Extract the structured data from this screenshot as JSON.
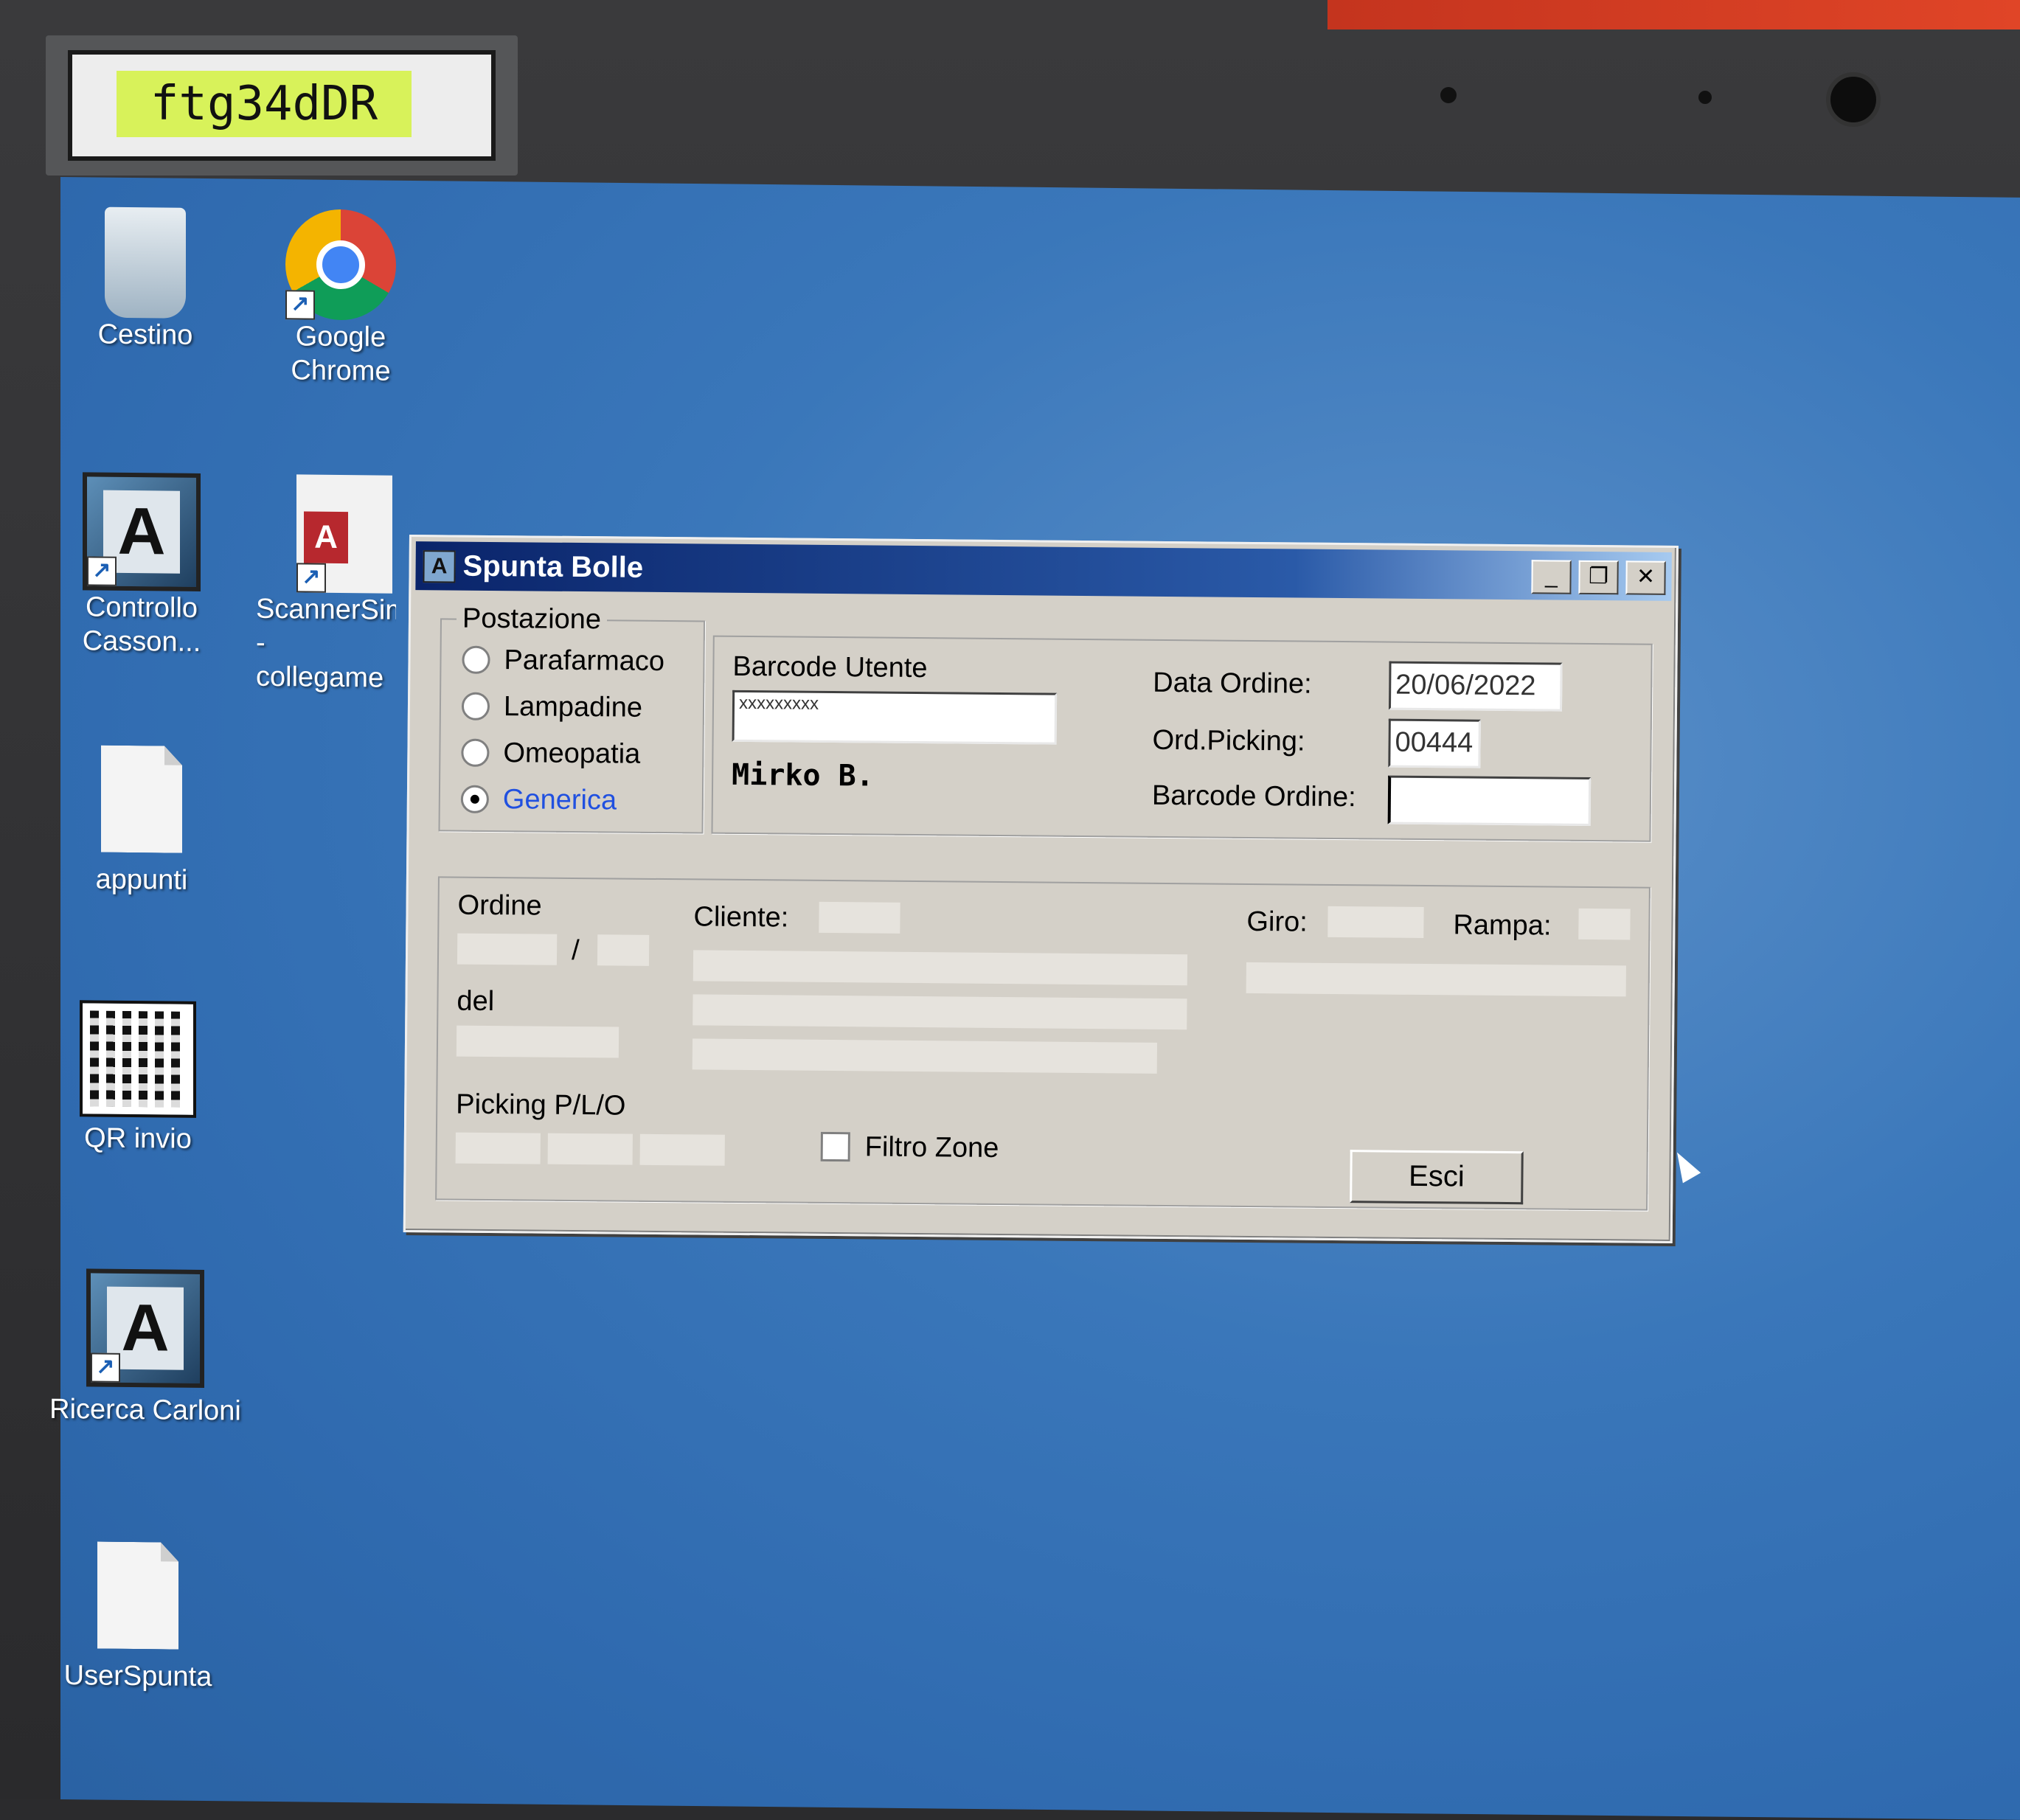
{
  "sticker": {
    "label": "ftg34dDR"
  },
  "desktop": {
    "icons": [
      {
        "label": "Cestino"
      },
      {
        "label": "Google Chrome"
      },
      {
        "label": "Controllo Casson..."
      },
      {
        "label": "ScannerSim - collegame"
      },
      {
        "label": "appunti"
      },
      {
        "label": "QR invio"
      },
      {
        "label": "Ricerca Carloni"
      },
      {
        "label": "UserSpunta"
      }
    ]
  },
  "dialog": {
    "title": "Spunta Bolle",
    "title_icon": "A",
    "postazione": {
      "legend": "Postazione",
      "options": [
        "Parafarmaco",
        "Lampadine",
        "Omeopatia",
        "Generica"
      ],
      "selected": "Generica"
    },
    "barcode_utente": {
      "label": "Barcode Utente",
      "value": "xxxxxxxxx",
      "user_name": "Mirko B."
    },
    "data_ordine": {
      "label": "Data Ordine:",
      "value": "20/06/2022"
    },
    "ord_picking": {
      "label": "Ord.Picking:",
      "value": "00444"
    },
    "barcode_ordine": {
      "label": "Barcode Ordine:",
      "value": ""
    },
    "ordine": {
      "label": "Ordine",
      "separator": "/"
    },
    "del_label": "del",
    "cliente_label": "Cliente:",
    "giro_label": "Giro:",
    "rampa_label": "Rampa:",
    "picking_label": "Picking P/L/O",
    "filtro_zone": {
      "label": "Filtro Zone",
      "checked": false
    },
    "esci_button": "Esci"
  }
}
